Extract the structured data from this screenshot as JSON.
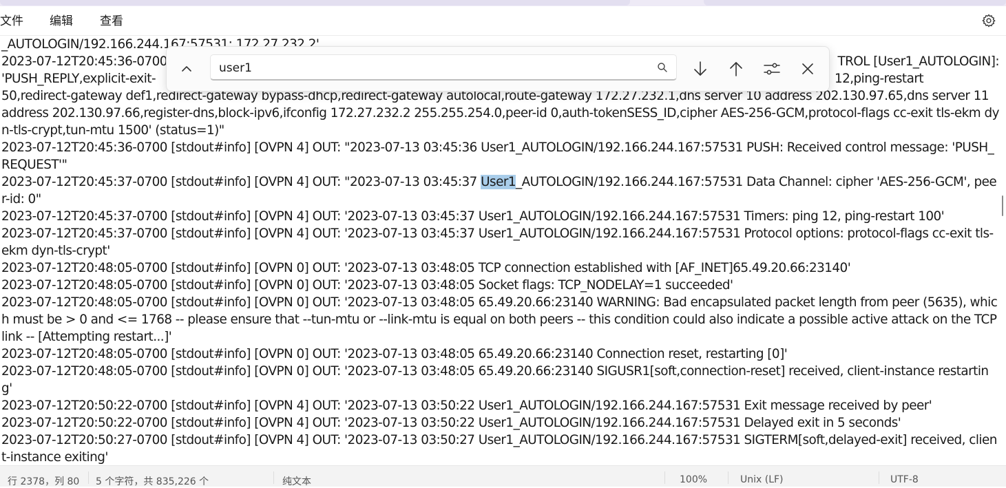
{
  "menubar": {
    "file": "文件",
    "edit": "编辑",
    "view": "查看",
    "settings_icon": "gear-icon"
  },
  "find": {
    "query": "user1",
    "icons": [
      "chevron-up-icon",
      "search-icon",
      "arrow-down-icon",
      "arrow-up-icon",
      "options-icon",
      "close-icon"
    ]
  },
  "log": {
    "top_fragment": "_AUTOLOGIN/192.166.244.167:57531: 172.27.232.2'",
    "line_push_reply_start": "2023-07-12T20:45:36-0700",
    "line_push_reply_end": "TROL [User1_AUTOLOGIN]:",
    "line_push_reply_wrap_start": "'PUSH_REPLY,explicit-exit-",
    "line_push_reply_wrap_end": "12,ping-restart",
    "line_push_reply_cont": "50,redirect-gateway def1,redirect-gateway bypass-dhcp,redirect-gateway autolocal,route-gateway 172.27.232.1,dns server 10 address 202.130.97.65,dns server 11 address 202.130.97.66,register-dns,block-ipv6,ifconfig 172.27.232.2 255.255.254.0,peer-id 0,auth-tokenSESS_ID,cipher AES-256-GCM,protocol-flags cc-exit tls-ekm dyn-tls-crypt,tun-mtu 1500' (status=1)\"",
    "line_push_request": "2023-07-12T20:45:36-0700 [stdout#info] [OVPN 4] OUT: \"2023-07-13 03:45:36 User1_AUTOLOGIN/192.166.244.167:57531 PUSH: Received control message: 'PUSH_REQUEST'\"",
    "line_data_channel_before": "2023-07-12T20:45:37-0700 [stdout#info] [OVPN 4] OUT: \"2023-07-13 03:45:37 ",
    "line_data_channel_match": "User1",
    "line_data_channel_after": "_AUTOLOGIN/192.166.244.167:57531 Data Channel: cipher 'AES-256-GCM', peer-id: 0\"",
    "line_timers": "2023-07-12T20:45:37-0700 [stdout#info] [OVPN 4] OUT: '2023-07-13 03:45:37 User1_AUTOLOGIN/192.166.244.167:57531 Timers: ping 12, ping-restart 100'",
    "line_protocol": "2023-07-12T20:45:37-0700 [stdout#info] [OVPN 4] OUT: '2023-07-13 03:45:37 User1_AUTOLOGIN/192.166.244.167:57531 Protocol options: protocol-flags cc-exit tls-ekm dyn-tls-crypt'",
    "line_tcp": "2023-07-12T20:48:05-0700 [stdout#info] [OVPN 0] OUT: '2023-07-13 03:48:05 TCP connection established with [AF_INET]65.49.20.66:23140'",
    "line_socket": "2023-07-12T20:48:05-0700 [stdout#info] [OVPN 0] OUT: '2023-07-13 03:48:05 Socket flags: TCP_NODELAY=1 succeeded'",
    "line_warning": "2023-07-12T20:48:05-0700 [stdout#info] [OVPN 0] OUT: '2023-07-13 03:48:05 65.49.20.66:23140 WARNING: Bad encapsulated packet length from peer (5635), which must be > 0 and <= 1768 -- please ensure that --tun-mtu or --link-mtu is equal on both peers -- this condition could also indicate a possible active attack on the TCP link -- [Attempting restart...]'",
    "line_reset": "2023-07-12T20:48:05-0700 [stdout#info] [OVPN 0] OUT: '2023-07-13 03:48:05 65.49.20.66:23140 Connection reset, restarting [0]'",
    "line_sigusr1": "2023-07-12T20:48:05-0700 [stdout#info] [OVPN 0] OUT: '2023-07-13 03:48:05 65.49.20.66:23140 SIGUSR1[soft,connection-reset] received, client-instance restarting'",
    "line_exit_msg": "2023-07-12T20:50:22-0700 [stdout#info] [OVPN 4] OUT: '2023-07-13 03:50:22 User1_AUTOLOGIN/192.166.244.167:57531 Exit message received by peer'",
    "line_delayed": "2023-07-12T20:50:22-0700 [stdout#info] [OVPN 4] OUT: '2023-07-13 03:50:22 User1_AUTOLOGIN/192.166.244.167:57531 Delayed exit in 5 seconds'",
    "line_sigterm": "2023-07-12T20:50:27-0700 [stdout#info] [OVPN 4] OUT: '2023-07-13 03:50:27 User1_AUTOLOGIN/192.166.244.167:57531 SIGTERM[soft,delayed-exit] received, client-instance exiting'"
  },
  "statusbar": {
    "position": "行 2378，列 80",
    "selection": "5 个字符，共 835,226 个",
    "format": "纯文本",
    "zoom": "100%",
    "line_ending": "Unix (LF)",
    "encoding": "UTF-8"
  },
  "colors": {
    "highlight": "#a9cdea",
    "statusbar_bg": "#f3f3f3"
  }
}
